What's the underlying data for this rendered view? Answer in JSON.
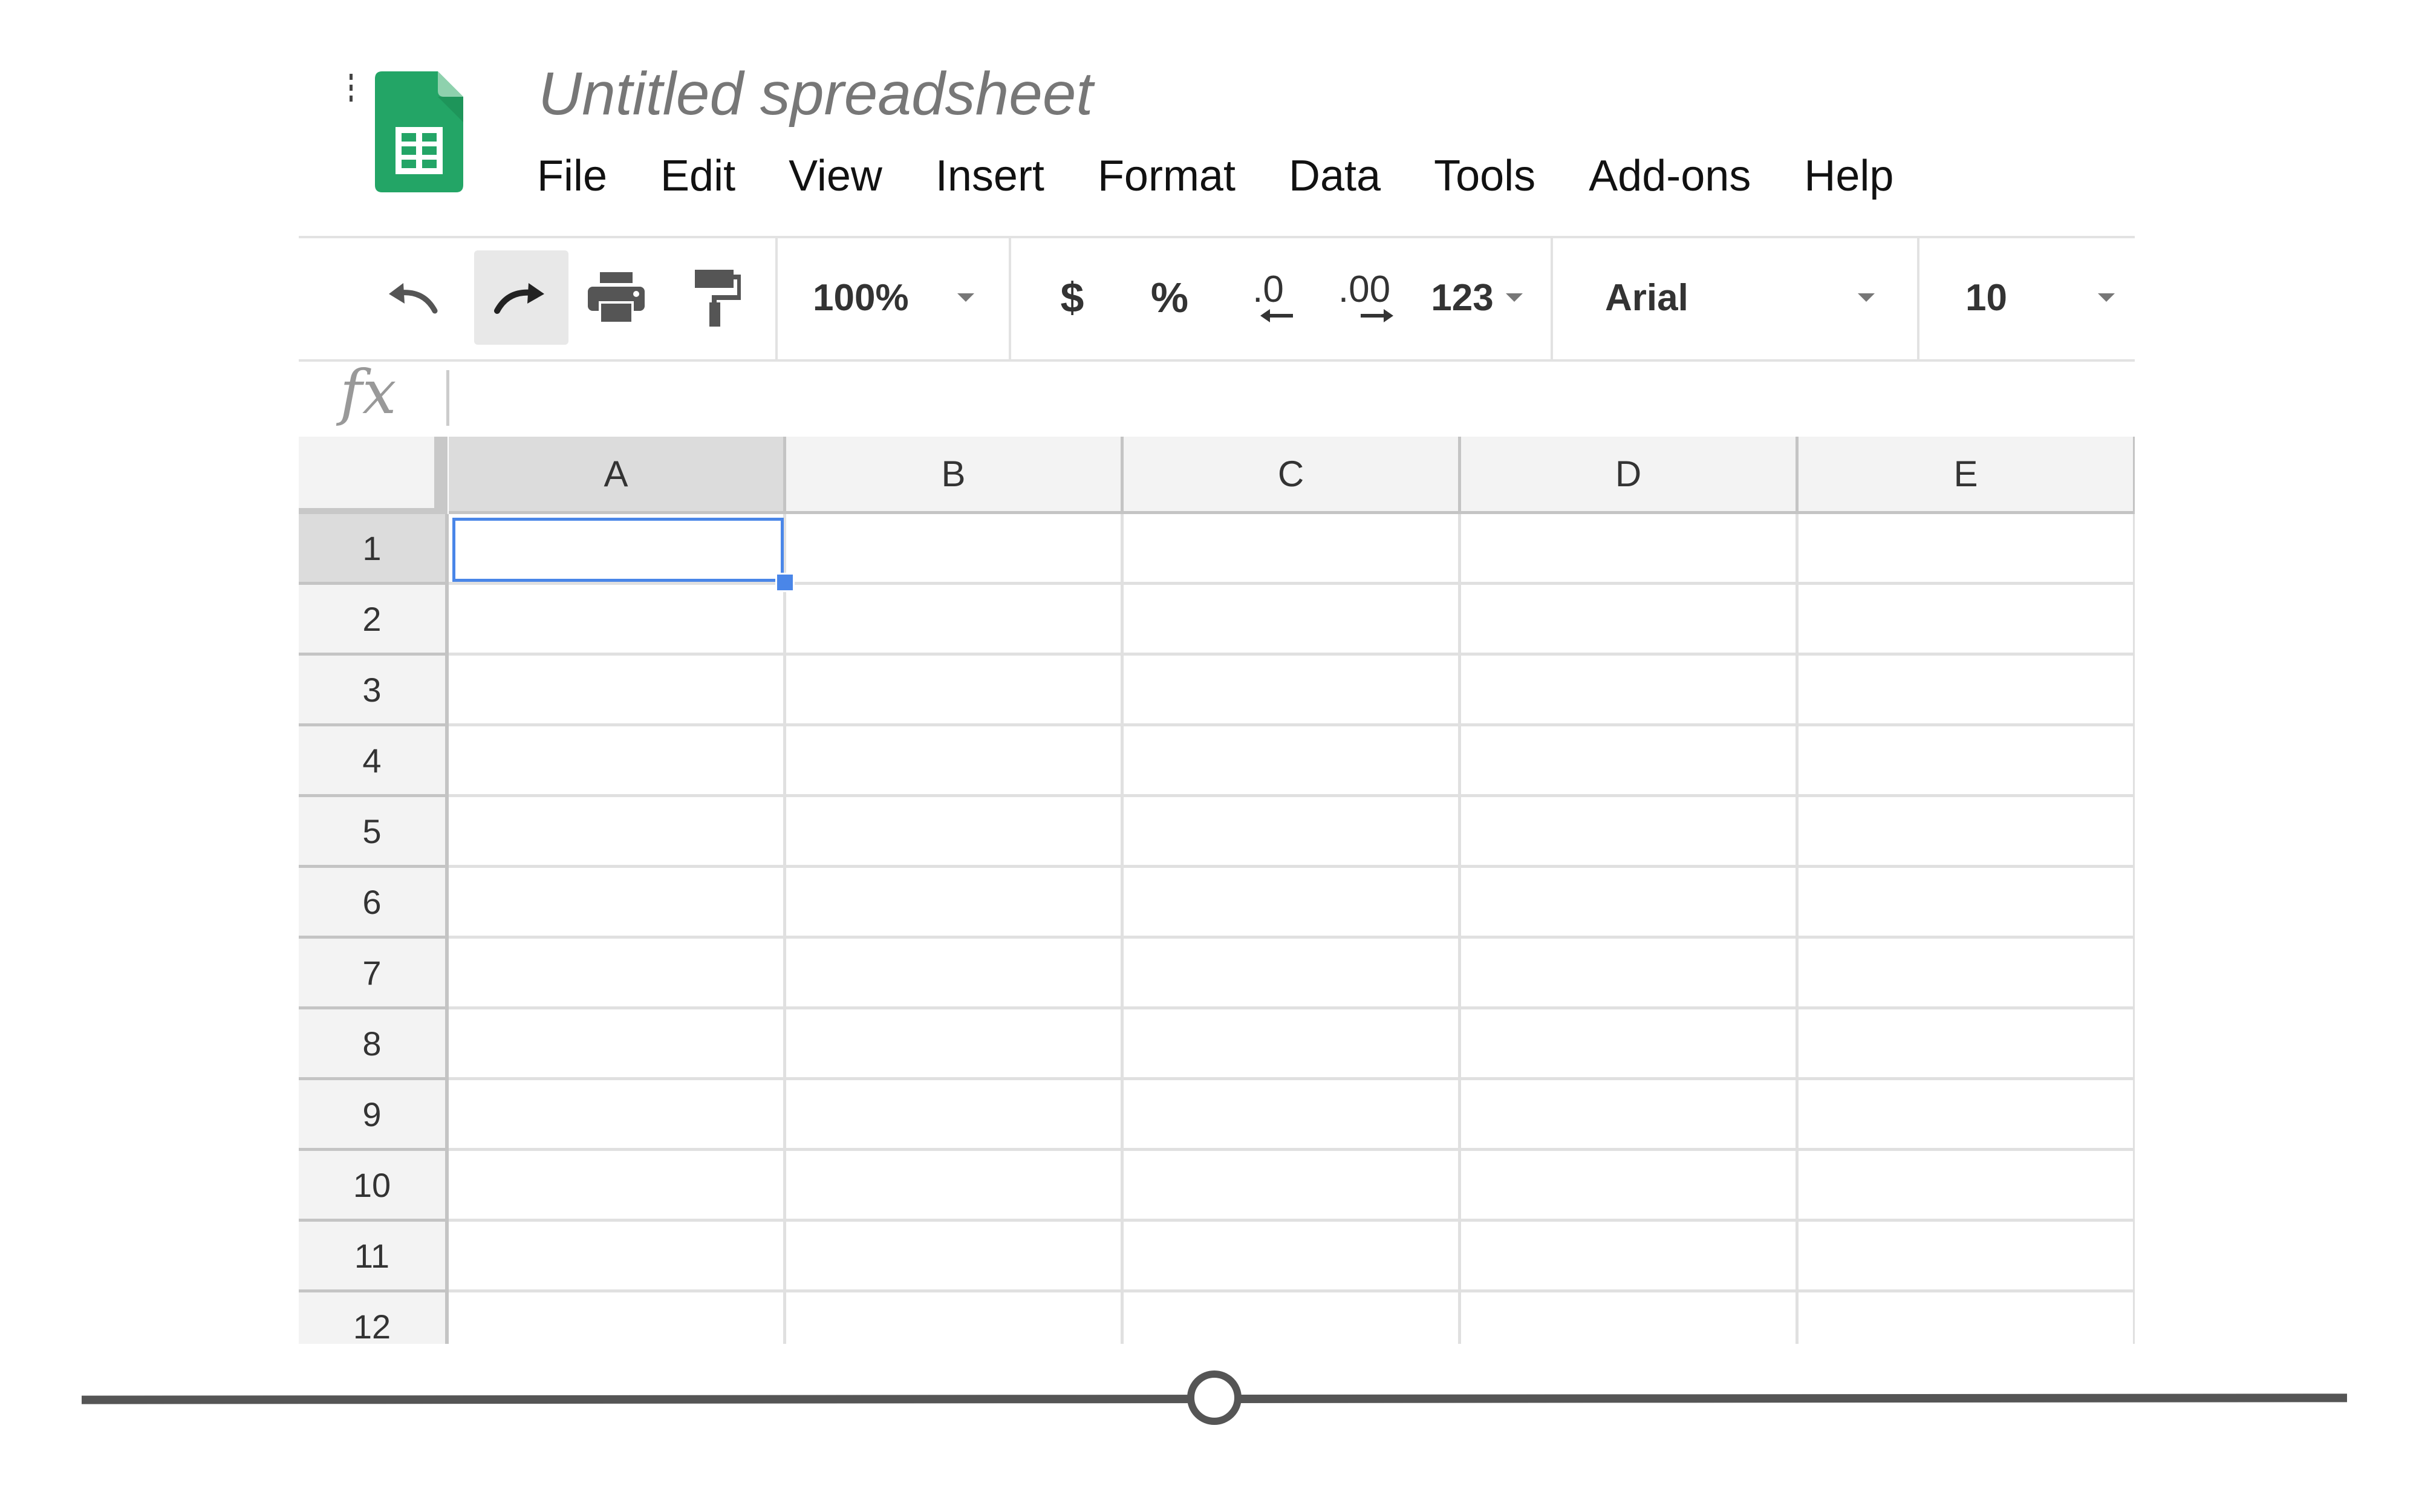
{
  "app": {
    "title": "Untitled spreadsheet",
    "brand_color": "#23a566"
  },
  "menu": [
    {
      "label": "File"
    },
    {
      "label": "Edit"
    },
    {
      "label": "View"
    },
    {
      "label": "Insert"
    },
    {
      "label": "Format"
    },
    {
      "label": "Data"
    },
    {
      "label": "Tools"
    },
    {
      "label": "Add-ons"
    },
    {
      "label": "Help"
    }
  ],
  "toolbar": {
    "undo_icon": "undo-icon",
    "redo_icon": "redo-icon",
    "print_icon": "print-icon",
    "paint_format_icon": "paint-format-icon",
    "zoom": "100%",
    "currency": "$",
    "percent": "%",
    "decrease_decimal": ".0",
    "increase_decimal": ".00",
    "more_formats": "123",
    "font": "Arial",
    "font_size": "10"
  },
  "formula_bar": {
    "label": "fx",
    "value": ""
  },
  "grid": {
    "columns": [
      "A",
      "B",
      "C",
      "D",
      "E"
    ],
    "rows": [
      "1",
      "2",
      "3",
      "4",
      "5",
      "6",
      "7",
      "8",
      "9",
      "10",
      "11",
      "12"
    ],
    "selected_cell": "A1",
    "selection_color": "#4a86e8"
  },
  "slider": {
    "value_fraction": 0.5
  }
}
